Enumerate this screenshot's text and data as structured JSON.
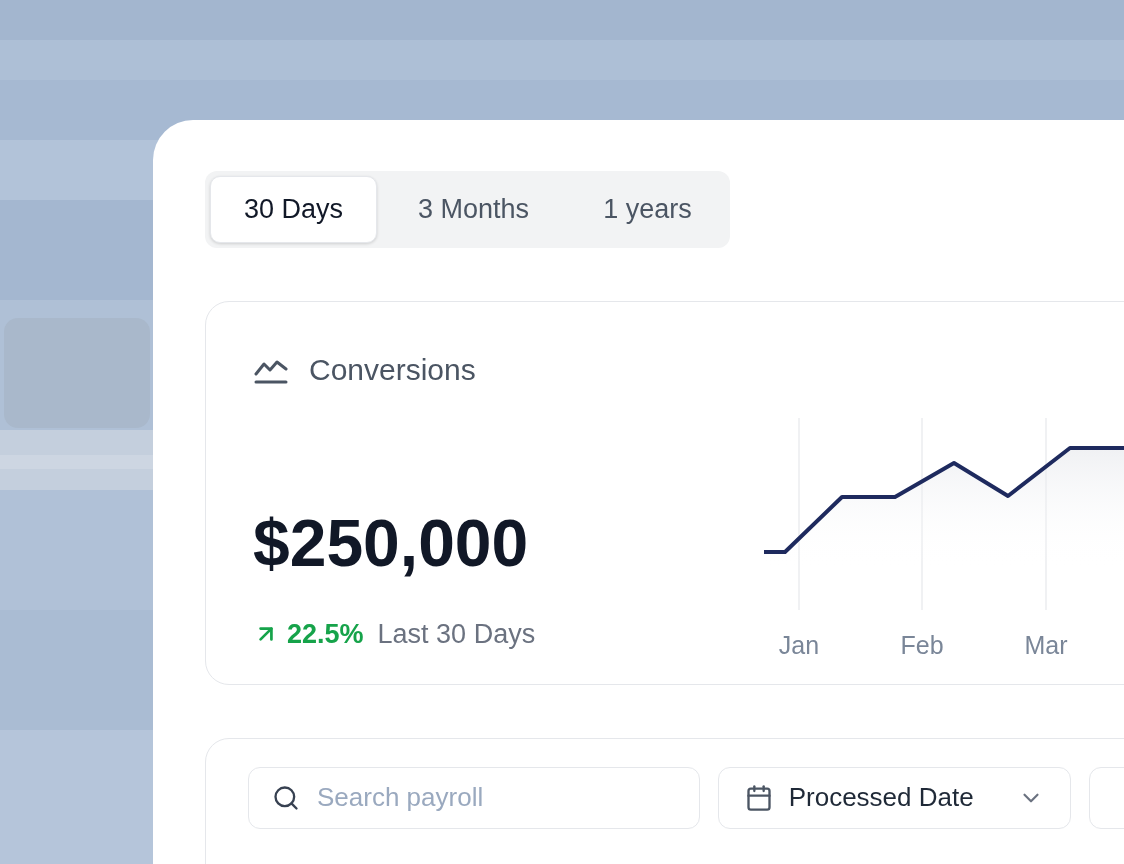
{
  "range_tabs": [
    {
      "label": "30 Days",
      "selected": true
    },
    {
      "label": "3 Months",
      "selected": false
    },
    {
      "label": "1 years",
      "selected": false
    }
  ],
  "conversions_card": {
    "title": "Conversions",
    "amount": "$250,000",
    "change": {
      "rising": true,
      "value": "22.5%"
    },
    "period": "Last 30 Days",
    "months": [
      "Jan",
      "Feb",
      "Mar"
    ]
  },
  "filters": {
    "search": {
      "placeholder": "Search payroll"
    },
    "date_filter": {
      "label": "Processed Date"
    }
  }
}
